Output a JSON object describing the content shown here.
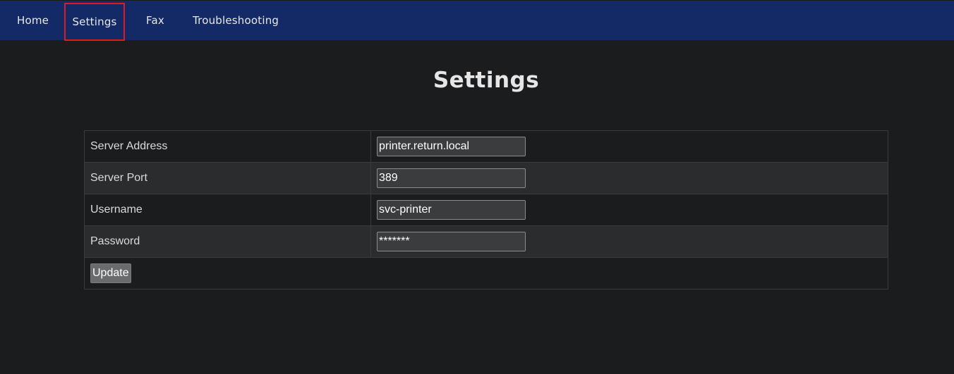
{
  "nav": {
    "items": [
      {
        "label": "Home"
      },
      {
        "label": "Settings"
      },
      {
        "label": "Fax"
      },
      {
        "label": "Troubleshooting"
      }
    ]
  },
  "page": {
    "title": "Settings"
  },
  "form": {
    "rows": [
      {
        "label": "Server Address",
        "value": "printer.return.local"
      },
      {
        "label": "Server Port",
        "value": "389"
      },
      {
        "label": "Username",
        "value": "svc-printer"
      },
      {
        "label": "Password",
        "value": "*******"
      }
    ],
    "update_label": "Update"
  },
  "colors": {
    "nav_background": "#142a66",
    "page_background": "#1b1c1e",
    "highlight_border": "#e01a22"
  }
}
